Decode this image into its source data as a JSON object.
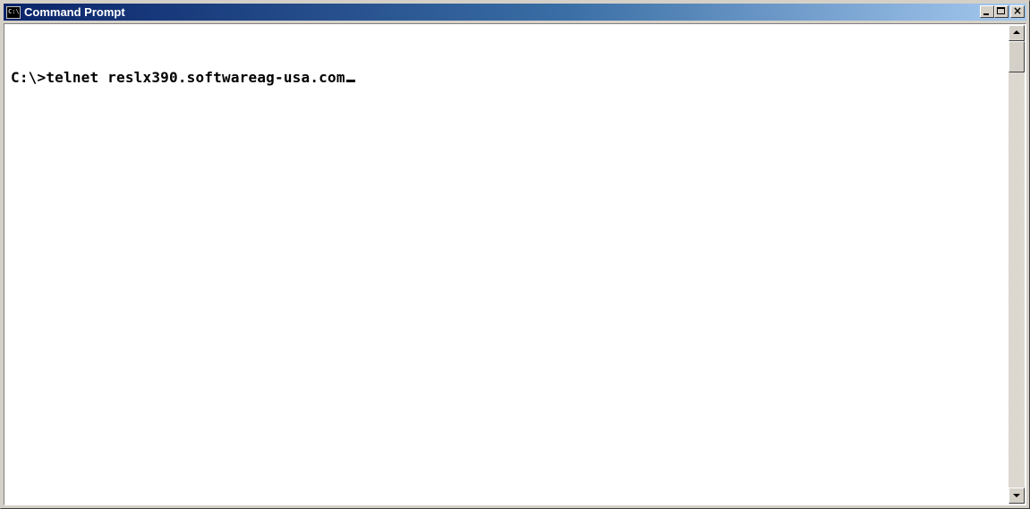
{
  "window": {
    "title": "Command Prompt",
    "icon": "cmd-console-icon",
    "icon_text": "C:\\"
  },
  "caption_buttons": {
    "minimize": "minimize-icon",
    "maximize": "maximize-icon",
    "close": "close-icon",
    "close_glyph": "×"
  },
  "console": {
    "prompt": "C:\\>",
    "command": "telnet reslx390.softwareag-usa.com"
  },
  "scrollbar": {
    "up": "scroll-up-arrow-icon",
    "down": "scroll-down-arrow-icon"
  },
  "colors": {
    "titlebar_start": "#0a246a",
    "titlebar_end": "#a6caf0",
    "console_bg": "#ffffff",
    "console_fg": "#000000",
    "chrome": "#d4d0c8"
  }
}
